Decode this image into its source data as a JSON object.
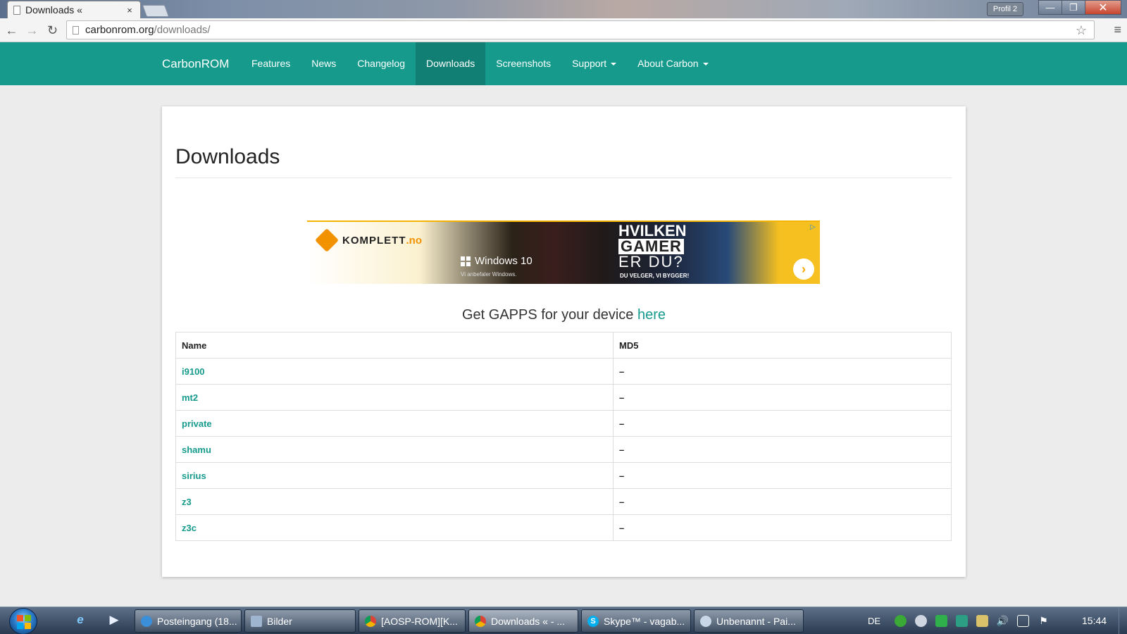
{
  "browser": {
    "tab_title": "Downloads «",
    "tab_close": "×",
    "profile": "Profil 2",
    "url_host": "carbonrom.org",
    "url_path": "/downloads/",
    "back_glyph": "←",
    "forward_glyph": "→",
    "reload_glyph": "↻",
    "star_glyph": "☆",
    "menu_glyph": "≡",
    "min_glyph": "—",
    "max_glyph": "❐",
    "close_glyph": "✕"
  },
  "site": {
    "brand": "CarbonROM",
    "nav": [
      {
        "label": "Features"
      },
      {
        "label": "News"
      },
      {
        "label": "Changelog"
      },
      {
        "label": "Downloads"
      },
      {
        "label": "Screenshots"
      },
      {
        "label": "Support"
      },
      {
        "label": "About Carbon"
      }
    ],
    "accent_color": "#159a8c"
  },
  "page": {
    "title": "Downloads",
    "gapps_text": "Get GAPPS for your device ",
    "gapps_link": "here"
  },
  "ad": {
    "brand": "KOMPLETT",
    "brand_tld": ".no",
    "windows": "Windows 10",
    "windows_sub": "Vi anbefaler Windows.",
    "headline1": "HVILKEN",
    "headline2": "GAMER",
    "headline3": "ER DU?",
    "tagline": "DU VELGER, VI BYGGER!",
    "arrow_glyph": "›",
    "choices_glyph": "▷"
  },
  "table": {
    "headers": {
      "name": "Name",
      "md5": "MD5"
    },
    "rows": [
      {
        "name": "i9100",
        "md5": "–"
      },
      {
        "name": "mt2",
        "md5": "–"
      },
      {
        "name": "private",
        "md5": "–"
      },
      {
        "name": "shamu",
        "md5": "–"
      },
      {
        "name": "sirius",
        "md5": "–"
      },
      {
        "name": "z3",
        "md5": "–"
      },
      {
        "name": "z3c",
        "md5": "–"
      }
    ]
  },
  "taskbar": {
    "items": [
      {
        "label": "Posteingang (18..."
      },
      {
        "label": "Bilder"
      },
      {
        "label": "[AOSP-ROM][K..."
      },
      {
        "label": "Downloads « - ..."
      },
      {
        "label": "Skype™ - vagab..."
      },
      {
        "label": "Unbenannt - Pai..."
      }
    ],
    "skype_letter": "S",
    "lang": "DE",
    "clock": "15:44"
  }
}
